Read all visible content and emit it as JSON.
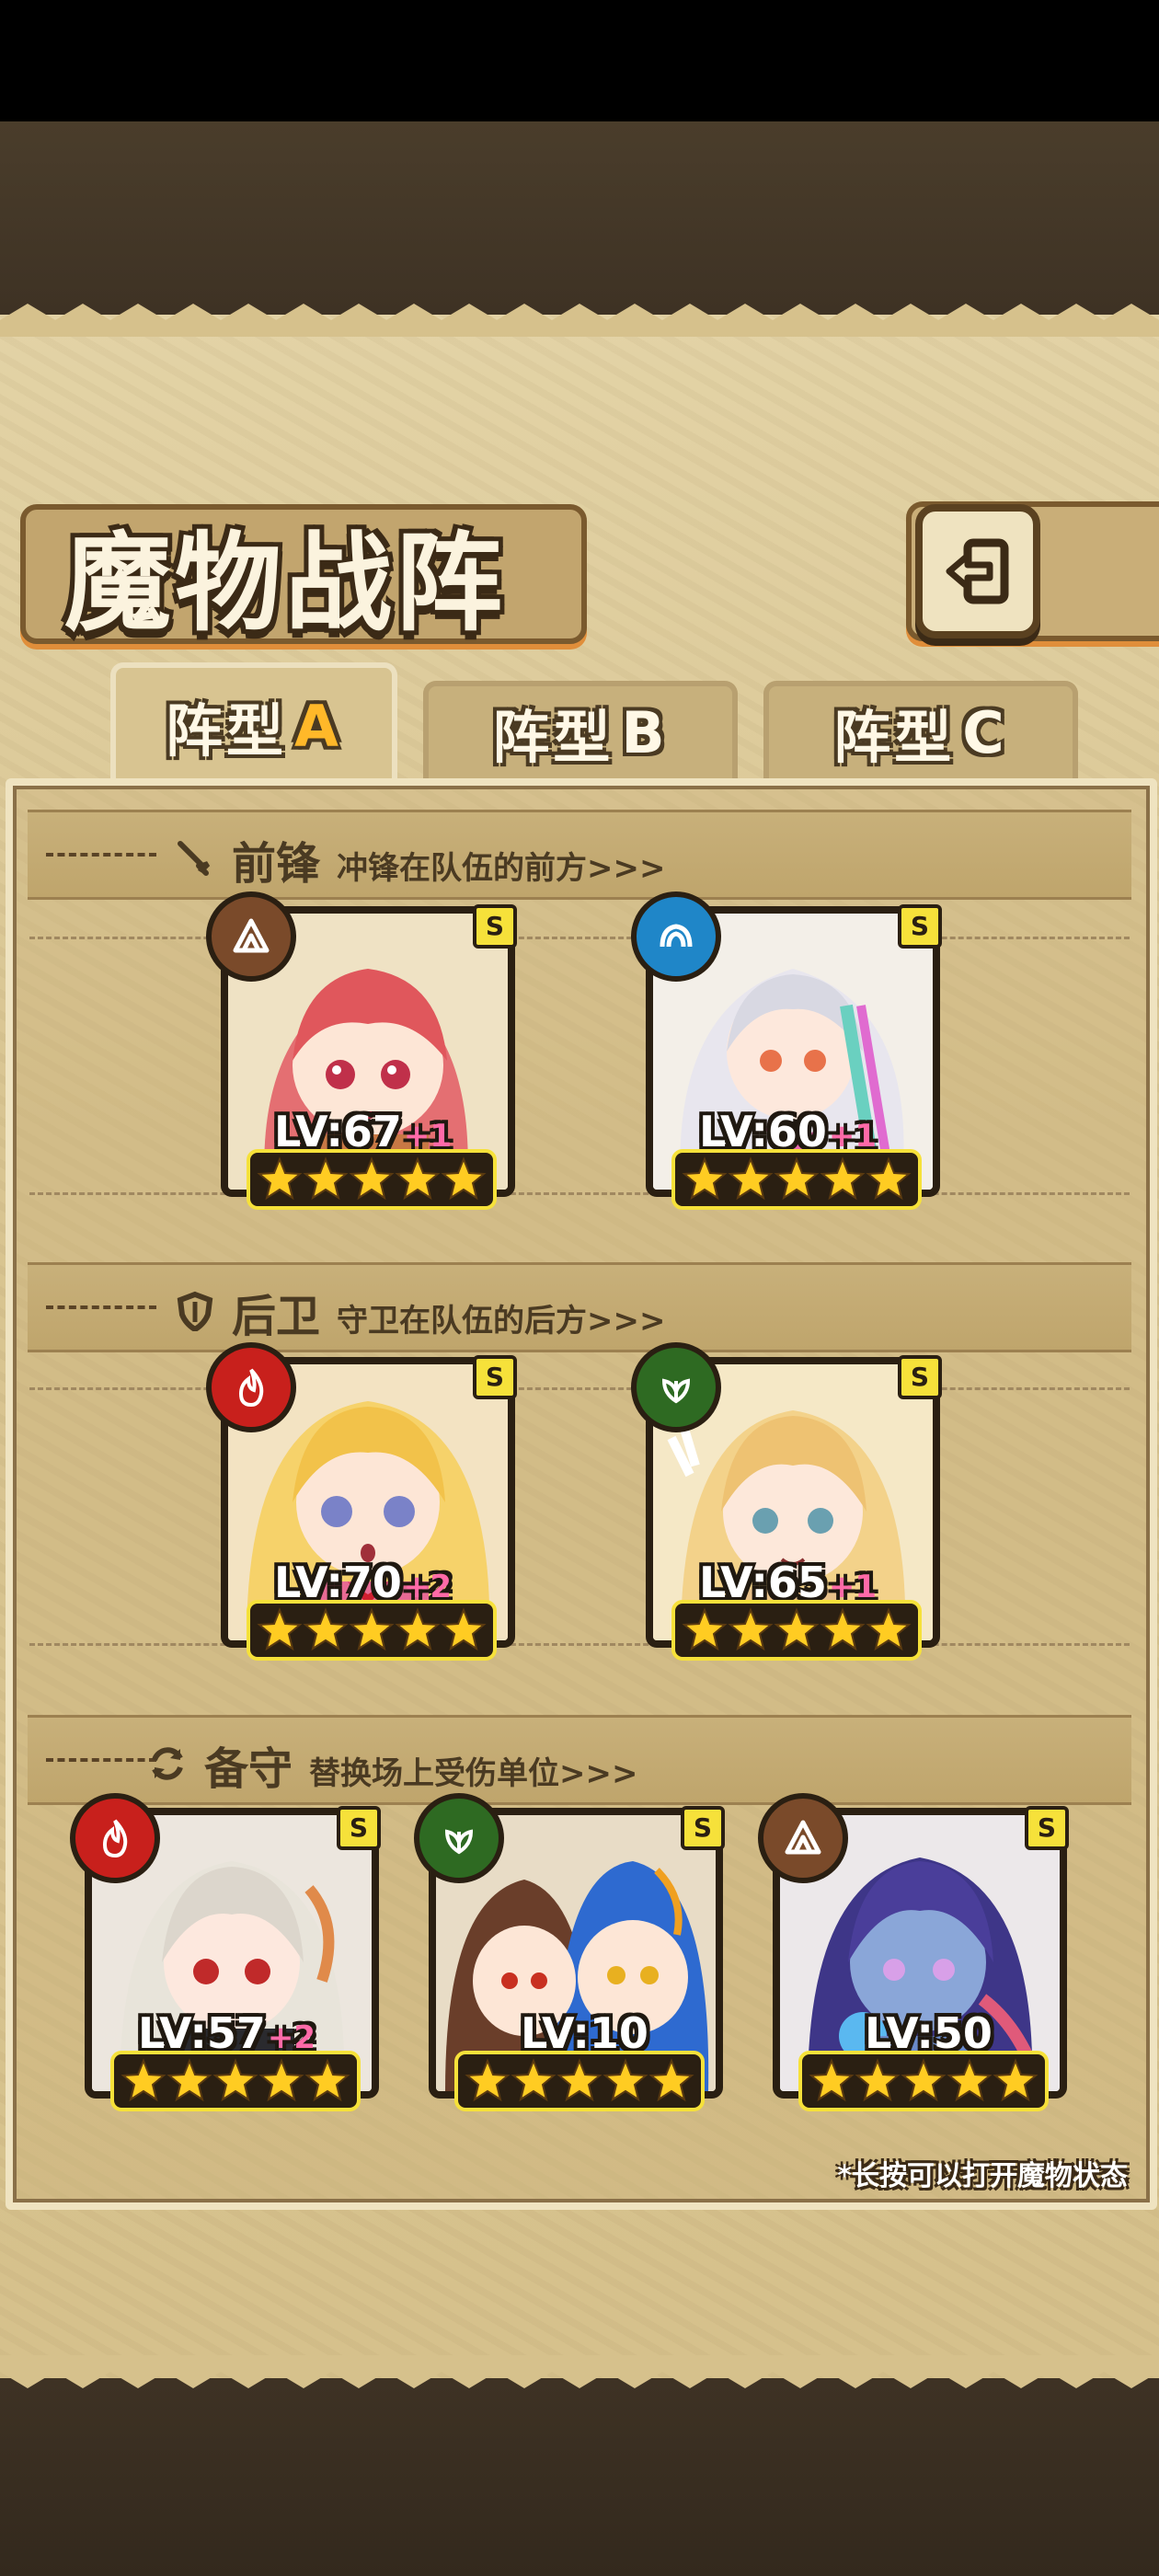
{
  "title": "魔物战阵",
  "tabs": [
    {
      "label": "阵型",
      "suffix": "A",
      "active": true
    },
    {
      "label": "阵型",
      "suffix": "B",
      "active": false
    },
    {
      "label": "阵型",
      "suffix": "C",
      "active": false
    }
  ],
  "sections": {
    "front": {
      "title": "前锋",
      "desc": "冲锋在队伍的前方>>>",
      "icon": "sword-icon"
    },
    "back": {
      "title": "后卫",
      "desc": "守卫在队伍的后方>>>",
      "icon": "shield-icon"
    },
    "reserve": {
      "title": "备守",
      "desc": "替换场上受伤单位>>>",
      "icon": "cycle-icon"
    }
  },
  "cards": {
    "front1": {
      "level": "LV:67",
      "plus": "+1",
      "rank": "S",
      "element": "earth",
      "stars": 5
    },
    "front2": {
      "level": "LV:60",
      "plus": "+1",
      "rank": "S",
      "element": "water",
      "stars": 5
    },
    "back1": {
      "level": "LV:70",
      "plus": "+2",
      "rank": "S",
      "element": "fire",
      "stars": 5
    },
    "back2": {
      "level": "LV:65",
      "plus": "+1",
      "rank": "S",
      "element": "wind",
      "stars": 5
    },
    "reserve1": {
      "level": "LV:57",
      "plus": "+2",
      "rank": "S",
      "element": "fire",
      "stars": 5
    },
    "reserve2": {
      "level": "LV:10",
      "plus": "",
      "rank": "S",
      "element": "wind",
      "stars": 5
    },
    "reserve3": {
      "level": "LV:50",
      "plus": "",
      "rank": "S",
      "element": "earth",
      "stars": 5
    }
  },
  "footnote": "*长按可以打开魔物状态",
  "colors": {
    "fire": "#c8201c",
    "water": "#1f86c8",
    "wind": "#2e6a22",
    "earth": "#7a4a2a",
    "star": "#ffcc22",
    "frame_yellow": "#f6e13a"
  }
}
